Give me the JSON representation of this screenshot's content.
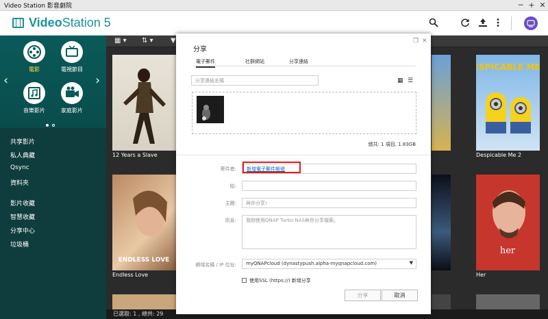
{
  "window": {
    "title": "Video Station 影音劇院",
    "min": "─",
    "max": "+",
    "close": "✕"
  },
  "app": {
    "name_bold": "Video",
    "name_rest": "Station 5",
    "avatar_initial": "👤"
  },
  "sidebar": {
    "categories": [
      {
        "label": "電影",
        "icon": "film-reel-icon",
        "glyph": "✇"
      },
      {
        "label": "電視節目",
        "icon": "tv-icon",
        "glyph": "📺"
      },
      {
        "label": "音樂影片",
        "icon": "music-video-icon",
        "glyph": "♫"
      },
      {
        "label": "家庭影片",
        "icon": "camcorder-icon",
        "glyph": "▶"
      }
    ],
    "items": [
      "共享影片",
      "私人典藏",
      "Qsync",
      "資料夾",
      "影片收藏",
      "智慧收藏",
      "分享中心",
      "垃圾桶"
    ]
  },
  "toolbar": {
    "grid": "▦ ▾",
    "sort": "⇅ ▾",
    "filter": "▼"
  },
  "posters": [
    {
      "title": "12 Years a Slave"
    },
    {
      "title": "Despicable Me 2",
      "art_title": "DESPICABLE ME 2"
    },
    {
      "title": "Endless Love",
      "art_title": "ENDLESS LOVE"
    },
    {
      "title": "Her",
      "art_title": "her"
    }
  ],
  "status": {
    "text": "已選取: 1 , 總共: 29"
  },
  "dialog": {
    "title": "分享",
    "tabs": [
      "電子郵件",
      "社群網站",
      "分享連結"
    ],
    "link_name_placeholder": "分享連結名稱",
    "total": "總共: 1 項目, 1.83GB",
    "sender_label": "寄件者:",
    "sender_link": "新增電子郵件帳號",
    "to_label": "給:",
    "subject_label": "主題:",
    "subject_placeholder": "與你分享!",
    "message_label": "訊息:",
    "message_placeholder": "我剛使用QNAP Turbo NAS與你分享檔案。",
    "domain_label": "網域名稱 / IP 位址:",
    "domain_value": "myQNAPcloud (dynastypush.alpha-myqnapcloud.com)",
    "ssl_label": "使用SSL (https://) 新增分享",
    "share_button": "分享",
    "cancel_button": "取消"
  }
}
